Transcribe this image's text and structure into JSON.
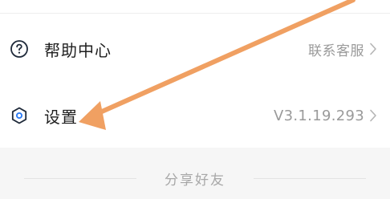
{
  "menu": {
    "help": {
      "icon": "question-circle-icon",
      "label": "帮助中心",
      "value": "联系客服"
    },
    "settings": {
      "icon": "hexagon-settings-icon",
      "label": "设置",
      "value": "V3.1.19.293"
    }
  },
  "share_section": {
    "title": "分享好友"
  },
  "annotation": {
    "icon": "pointer-arrow",
    "color": "#f0a062"
  },
  "colors": {
    "label_text": "#1f1f1f",
    "value_text": "#9a9a9a",
    "section_bg": "#f6f6f6"
  }
}
